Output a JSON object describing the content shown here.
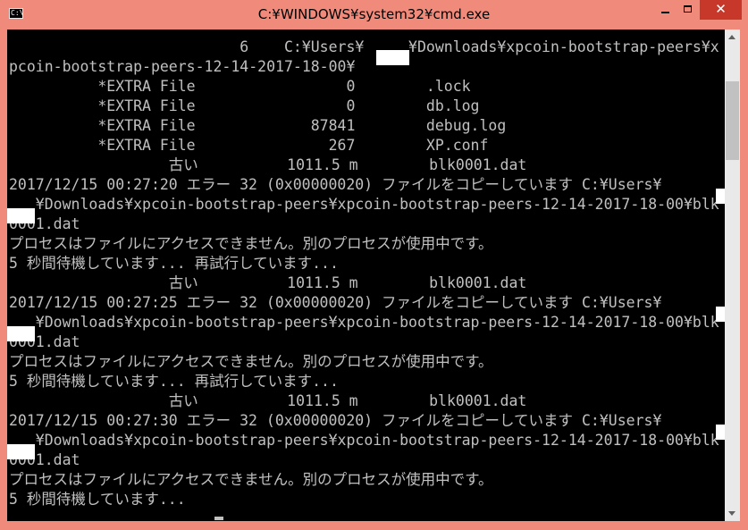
{
  "window": {
    "title": "C:¥WINDOWS¥system32¥cmd.exe",
    "icon_label": "C:\\",
    "close_glyph": "✕"
  },
  "colors": {
    "titlebar": "#f08a7a",
    "close": "#c7382a",
    "console_bg": "#000000",
    "console_text": "#c0c0c0"
  },
  "lines": [
    "                          6    C:¥Users¥     ¥Downloads¥xpcoin-bootstrap-peers¥x",
    "pcoin-bootstrap-peers-12-14-2017-18-00¥",
    "          *EXTRA File                 0        .lock",
    "          *EXTRA File                 0        db.log",
    "          *EXTRA File             87841        debug.log",
    "          *EXTRA File               267        XP.conf",
    "                  古い          1011.5 m        blk0001.dat",
    "2017/12/15 00:27:20 エラー 32 (0x00000020) ファイルをコピーしています C:¥Users¥",
    "   ¥Downloads¥xpcoin-bootstrap-peers¥xpcoin-bootstrap-peers-12-14-2017-18-00¥blk",
    "0001.dat",
    "プロセスはファイルにアクセスできません。別のプロセスが使用中です。",
    "5 秒間待機しています... 再試行しています...",
    "                  古い          1011.5 m        blk0001.dat",
    "2017/12/15 00:27:25 エラー 32 (0x00000020) ファイルをコピーしています C:¥Users¥",
    "   ¥Downloads¥xpcoin-bootstrap-peers¥xpcoin-bootstrap-peers-12-14-2017-18-00¥blk",
    "0001.dat",
    "プロセスはファイルにアクセスできません。別のプロセスが使用中です。",
    "5 秒間待機しています... 再試行しています...",
    "                  古い          1011.5 m        blk0001.dat",
    "2017/12/15 00:27:30 エラー 32 (0x00000020) ファイルをコピーしています C:¥Users¥",
    "   ¥Downloads¥xpcoin-bootstrap-peers¥xpcoin-bootstrap-peers-12-14-2017-18-00¥blk",
    "0001.dat",
    "プロセスはファイルにアクセスできません。別のプロセスが使用中です。",
    "5 秒間待機しています..."
  ]
}
